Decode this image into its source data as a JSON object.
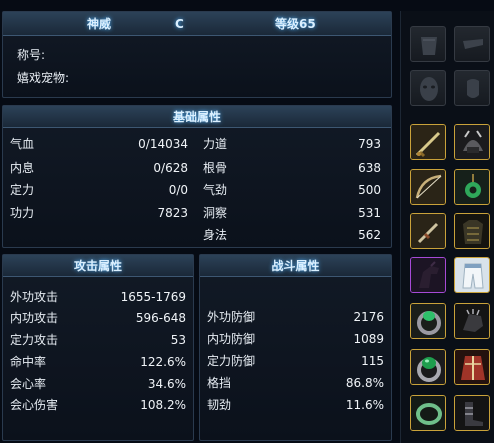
{
  "header": {
    "name": "神威",
    "grade": "C",
    "level": "等级65"
  },
  "profile": {
    "title_label": "称号:",
    "pet_label": "嬉戏宠物:"
  },
  "basic": {
    "title": "基础属性",
    "left": [
      {
        "label": "气血",
        "value": "0/14034"
      },
      {
        "label": "内息",
        "value": "0/628"
      },
      {
        "label": "定力",
        "value": "0/0"
      },
      {
        "label": "功力",
        "value": "7823"
      }
    ],
    "right": [
      {
        "label": "力道",
        "value": "793"
      },
      {
        "label": "根骨",
        "value": "638"
      },
      {
        "label": "气劲",
        "value": "500"
      },
      {
        "label": "洞察",
        "value": "531"
      },
      {
        "label": "身法",
        "value": "562"
      }
    ]
  },
  "attack": {
    "title": "攻击属性",
    "rows": [
      {
        "label": "外功攻击",
        "value": "1655-1769"
      },
      {
        "label": "内功攻击",
        "value": "596-648"
      },
      {
        "label": "定力攻击",
        "value": "53"
      },
      {
        "label": "命中率",
        "value": "122.6%"
      },
      {
        "label": "会心率",
        "value": "34.6%"
      },
      {
        "label": "会心伤害",
        "value": "108.2%"
      }
    ]
  },
  "combat": {
    "title": "战斗属性",
    "rows": [
      {
        "label": "外功防御",
        "value": "2176"
      },
      {
        "label": "内功防御",
        "value": "1089"
      },
      {
        "label": "定力防御",
        "value": "115"
      },
      {
        "label": "格挡",
        "value": "86.8%"
      },
      {
        "label": "韧劲",
        "value": "11.6%"
      }
    ]
  },
  "equipment": {
    "slots": [
      {
        "icon": "empty-cape-slot-icon",
        "rarity": "empty"
      },
      {
        "icon": "empty-weapon-slot-icon",
        "rarity": "empty"
      },
      {
        "icon": "empty-mask-slot-icon",
        "rarity": "empty"
      },
      {
        "icon": "empty-face-slot-icon",
        "rarity": "empty"
      },
      {
        "icon": "sword-icon",
        "rarity": "gold"
      },
      {
        "icon": "helmet-icon",
        "rarity": "gold"
      },
      {
        "icon": "bow-icon",
        "rarity": "gold"
      },
      {
        "icon": "jade-pendant-icon",
        "rarity": "gold"
      },
      {
        "icon": "dagger-icon",
        "rarity": "gold"
      },
      {
        "icon": "armor-icon",
        "rarity": "gold"
      },
      {
        "icon": "horse-icon",
        "rarity": "purple"
      },
      {
        "icon": "pants-icon",
        "rarity": "gold"
      },
      {
        "icon": "green-ring-icon",
        "rarity": "gold"
      },
      {
        "icon": "gauntlet-icon",
        "rarity": "gold"
      },
      {
        "icon": "emerald-ring-icon",
        "rarity": "gold"
      },
      {
        "icon": "robe-icon",
        "rarity": "gold"
      },
      {
        "icon": "jade-bracelet-icon",
        "rarity": "gold"
      },
      {
        "icon": "boots-icon",
        "rarity": "gold"
      }
    ]
  },
  "colors": {
    "header_glow": "#4fb3ff",
    "gold_border": "#c9a23a",
    "purple_border": "#a64ad6",
    "panel_border": "#2a3a4e"
  }
}
